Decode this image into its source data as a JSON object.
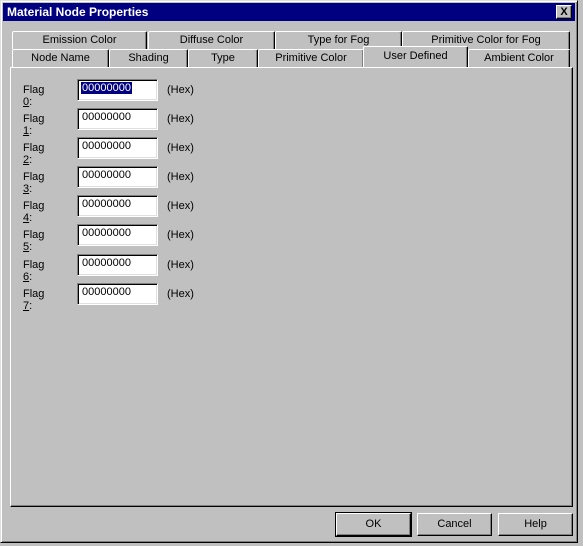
{
  "window": {
    "title": "Material Node Properties",
    "close_label": "X"
  },
  "tabs": {
    "top_row": [
      {
        "label": "Emission Color"
      },
      {
        "label": "Diffuse Color"
      },
      {
        "label": "Type for Fog"
      },
      {
        "label": "Primitive Color for Fog"
      }
    ],
    "bottom_row": [
      {
        "label": "Node Name"
      },
      {
        "label": "Shading"
      },
      {
        "label": "Type"
      },
      {
        "label": "Primitive Color"
      },
      {
        "label": "User Defined",
        "selected": true
      },
      {
        "label": "Ambient Color"
      }
    ]
  },
  "flags": [
    {
      "prefix": "Flag ",
      "mnemonic": "0",
      "suffix": ":",
      "value": "00000000",
      "unit": "(Hex)",
      "focused": true
    },
    {
      "prefix": "Flag ",
      "mnemonic": "1",
      "suffix": ":",
      "value": "00000000",
      "unit": "(Hex)"
    },
    {
      "prefix": "Flag ",
      "mnemonic": "2",
      "suffix": ":",
      "value": "00000000",
      "unit": "(Hex)"
    },
    {
      "prefix": "Flag ",
      "mnemonic": "3",
      "suffix": ":",
      "value": "00000000",
      "unit": "(Hex)"
    },
    {
      "prefix": "Flag ",
      "mnemonic": "4",
      "suffix": ":",
      "value": "00000000",
      "unit": "(Hex)"
    },
    {
      "prefix": "Flag ",
      "mnemonic": "5",
      "suffix": ":",
      "value": "00000000",
      "unit": "(Hex)"
    },
    {
      "prefix": "Flag ",
      "mnemonic": "6",
      "suffix": ":",
      "value": "00000000",
      "unit": "(Hex)"
    },
    {
      "prefix": "Flag ",
      "mnemonic": "7",
      "suffix": ":",
      "value": "00000000",
      "unit": "(Hex)"
    }
  ],
  "buttons": {
    "ok": "OK",
    "cancel": "Cancel",
    "help": "Help"
  },
  "colors": {
    "titlebar": "#000080",
    "face": "#c0c0c0",
    "selection": "#000080"
  }
}
